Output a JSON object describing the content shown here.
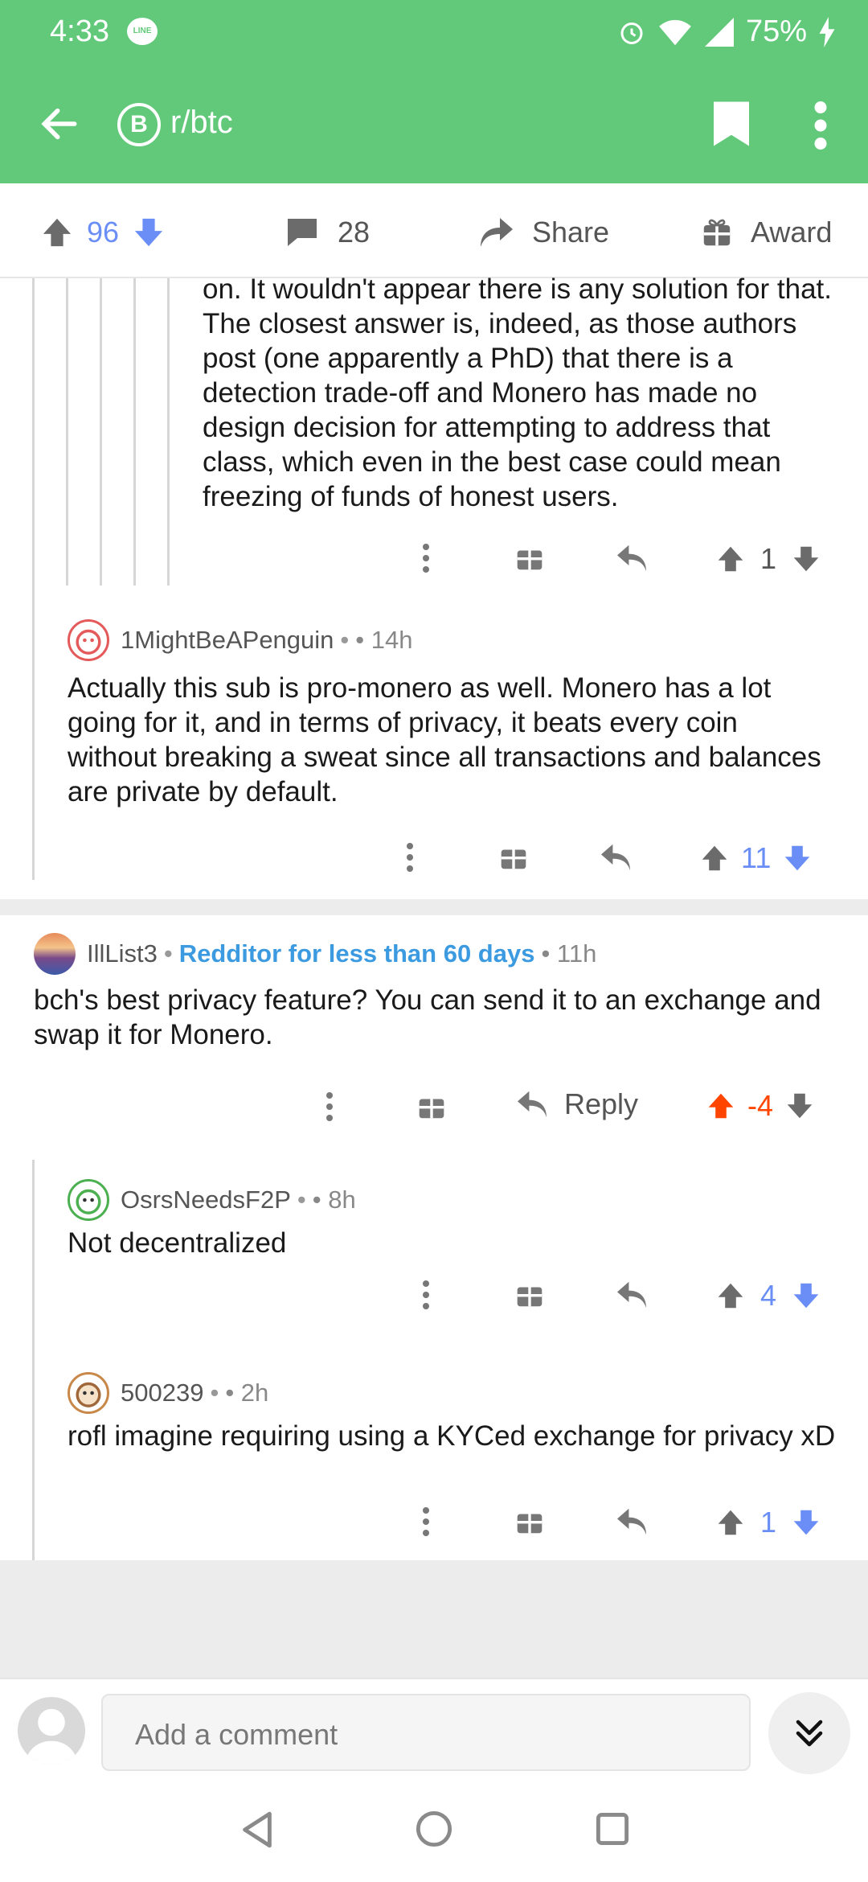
{
  "status": {
    "time": "4:33",
    "line_badge": "LINE",
    "battery": "75%"
  },
  "appbar": {
    "subreddit": "r/btc",
    "sub_icon_glyph": "B"
  },
  "post_actions": {
    "score": "96",
    "comments": "28",
    "share": "Share",
    "award": "Award"
  },
  "comments": [
    {
      "text": "on. It wouldn't appear there is any solution for that. The closest answer is, indeed, as those authors post (one apparently a PhD) that there is a detection trade-off and Monero has made no design decision for attempting to address that class, which even in the best case could mean freezing of funds of honest users.",
      "score": "1"
    },
    {
      "author": "1MightBeAPenguin",
      "dot": "•",
      "age": "• 14h",
      "text": "Actually this sub is pro-monero as well. Monero has a lot going for it, and in terms of privacy, it beats every coin without breaking a sweat since all transactions and balances are private by default.",
      "score": "11"
    },
    {
      "author": "IllList3",
      "dot": "•",
      "flair": "Redditor for less than 60 days",
      "age": "• 11h",
      "text": "bch's best privacy feature?  You can send it to an exchange and swap it for Monero.",
      "reply_label": "Reply",
      "score": "-4"
    },
    {
      "author": "OsrsNeedsF2P",
      "dot": "•",
      "age": "• 8h",
      "text": "Not decentralized",
      "score": "4"
    },
    {
      "author": "500239",
      "dot": "•",
      "age": "• 2h",
      "text": "rofl imagine requiring using a KYCed exchange for privacy xD",
      "score": "1"
    }
  ],
  "compose": {
    "placeholder": "Add a comment"
  },
  "colors": {
    "brand": "#62c97a",
    "upvote_blue": "#6a8ef6",
    "upvoted_orange": "#ff4500",
    "flair_blue": "#3c9be0"
  },
  "icons": [
    "back-arrow-icon",
    "bitcoin-icon",
    "bookmark-icon",
    "kebab-menu-icon",
    "upvote-icon",
    "downvote-icon",
    "comment-icon",
    "share-icon",
    "award-icon",
    "reply-icon",
    "collapse-icon"
  ]
}
